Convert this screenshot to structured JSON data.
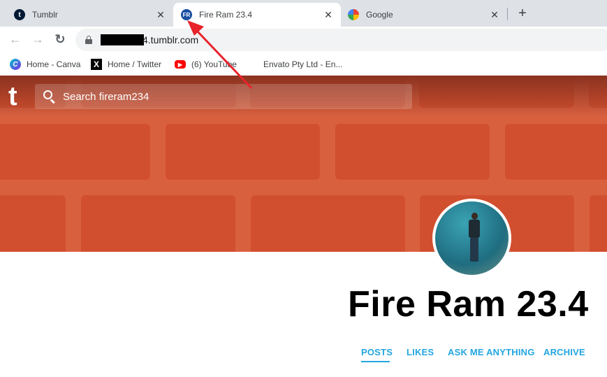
{
  "browser": {
    "tabs": [
      {
        "label": "Tumblr",
        "icon": "tumblr-icon",
        "active": false
      },
      {
        "label": "Fire Ram 23.4",
        "icon": "fr-avatar-icon",
        "icon_text": "FR",
        "active": true
      },
      {
        "label": "Google",
        "icon": "google-icon",
        "active": false
      }
    ],
    "close_glyph": "✕",
    "new_tab_glyph": "+",
    "url_visible": "4.tumblr.com",
    "url_redacted": true,
    "nav": {
      "back": "←",
      "forward": "→",
      "reload": "↻"
    },
    "bookmarks": [
      {
        "label": "Home - Canva",
        "icon": "canva-icon"
      },
      {
        "label": "Home / Twitter",
        "icon": "x-twitter-icon"
      },
      {
        "label": "(6) YouTube",
        "icon": "youtube-icon"
      },
      {
        "label": "Envato Pty Ltd - En...",
        "icon": "none"
      }
    ]
  },
  "blog": {
    "logo": "t",
    "search_placeholder": "Search fireram234",
    "title": "Fire Ram 23.4",
    "nav": [
      {
        "label": "POSTS",
        "active": true
      },
      {
        "label": "LIKES",
        "active": false
      },
      {
        "label": "ASK ME ANYTHING",
        "active": false
      },
      {
        "label": "ARCHIVE",
        "active": false
      }
    ]
  },
  "annotation": {
    "type": "red-arrow",
    "points_to": "Fire Ram 23.4 tab favicon",
    "color": "#e8232b"
  },
  "colors": {
    "accent": "#23a6e0",
    "header_bg": "#d9603f",
    "brick": "#d14f2f",
    "tab_strip": "#dee1e6"
  }
}
